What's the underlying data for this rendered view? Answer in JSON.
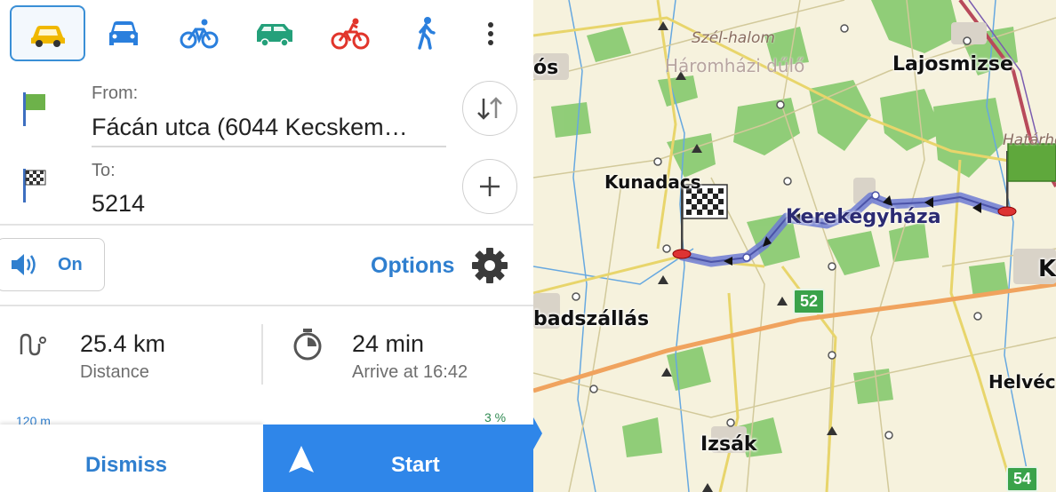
{
  "modes": [
    {
      "id": "car",
      "icon": "car-icon",
      "color": "#f0b800",
      "selected": true
    },
    {
      "id": "car-blue",
      "icon": "car-front-icon",
      "color": "#2a7fdd",
      "selected": false
    },
    {
      "id": "bike-blue",
      "icon": "bicycle-icon",
      "color": "#2a7fdd",
      "selected": false
    },
    {
      "id": "jeep",
      "icon": "suv-icon",
      "color": "#24a07a",
      "selected": false
    },
    {
      "id": "bike-red",
      "icon": "cyclist-icon",
      "color": "#e1352b",
      "selected": false
    },
    {
      "id": "walk",
      "icon": "pedestrian-icon",
      "color": "#2a7fdd",
      "selected": false
    }
  ],
  "route": {
    "from_label": "From:",
    "from_value": "Fácán utca (6044 Kecskem…",
    "to_label": "To:",
    "to_value": "5214"
  },
  "voice": {
    "label": "On",
    "icon": "speaker-icon"
  },
  "options_label": "Options",
  "stats": {
    "distance_value": "25.4 km",
    "distance_label": "Distance",
    "time_value": "24 min",
    "time_label": "Arrive at 16:42"
  },
  "elevation": {
    "left": "120 m",
    "right": "3 %"
  },
  "actions": {
    "dismiss": "Dismiss",
    "start": "Start"
  },
  "map": {
    "places": {
      "lajosmizse": "Lajosmizse",
      "kunadacs": "Kunadacs",
      "kerekegyhaza": "Kerekegyháza",
      "szabadszallas": "badszállás",
      "izsak": "Izsák",
      "helvecia": "Helvéc",
      "ocsa": "ós",
      "k_edge": "K"
    },
    "areas": {
      "szel_halom": "Szél-halom",
      "haromhazi": "Háromházi dűlő",
      "hatarho": "Határho"
    },
    "roads": {
      "r52": "52",
      "r54": "54"
    }
  },
  "colors": {
    "accent": "#2f7fcf",
    "start_bg": "#2f86e9",
    "route": "#6d7bd4",
    "forest": "#7fc86a",
    "map_bg": "#f6f2dd"
  }
}
